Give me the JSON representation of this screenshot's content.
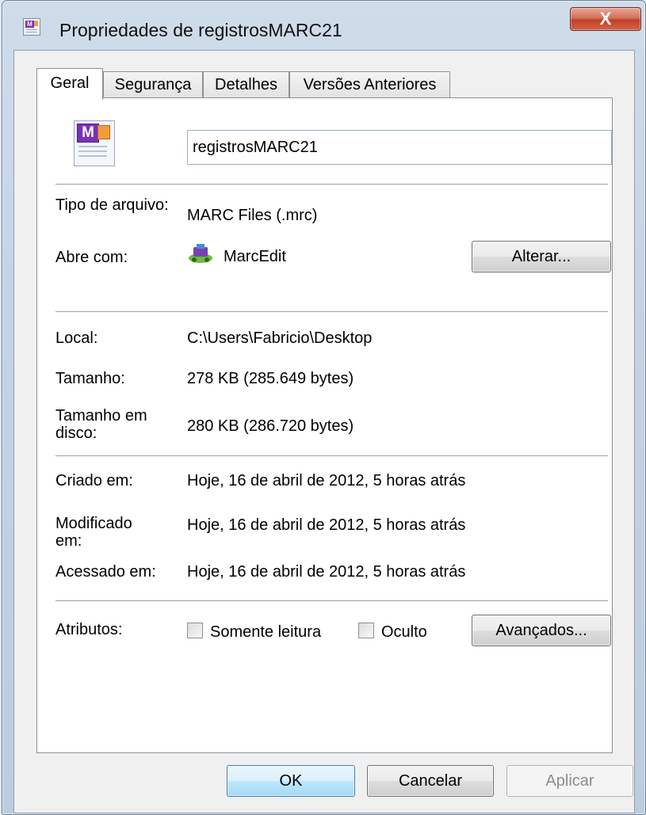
{
  "window": {
    "title": "Propriedades de registrosMARC21",
    "close_label": "X",
    "icon": "marc-file-icon"
  },
  "tabs": [
    {
      "label": "Geral",
      "active": true
    },
    {
      "label": "Segurança",
      "active": false
    },
    {
      "label": "Detalhes",
      "active": false
    },
    {
      "label": "Versões Anteriores",
      "active": false
    }
  ],
  "general": {
    "filename": "registrosMARC21",
    "file_type_label": "Tipo de arquivo:",
    "file_type_value": "MARC Files (.mrc)",
    "opens_with_label": "Abre com:",
    "opens_with_value": "MarcEdit",
    "change_button": "Alterar...",
    "location_label": "Local:",
    "location_value": "C:\\Users\\Fabricio\\Desktop",
    "size_label": "Tamanho:",
    "size_value": "278 KB (285.649 bytes)",
    "size_on_disk_label": "Tamanho em disco:",
    "size_on_disk_value": "280 KB (286.720 bytes)",
    "created_label": "Criado em:",
    "created_value": "Hoje, 16 de abril de 2012, 5 horas atrás",
    "modified_label": "Modificado em:",
    "modified_value": "Hoje, 16 de abril de 2012, 5 horas atrás",
    "accessed_label": "Acessado em:",
    "accessed_value": "Hoje, 16 de abril de 2012, 5 horas atrás",
    "attributes_label": "Atributos:",
    "readonly_label": "Somente leitura",
    "hidden_label": "Oculto",
    "advanced_button": "Avançados..."
  },
  "buttons": {
    "ok": "OK",
    "cancel": "Cancelar",
    "apply": "Aplicar"
  }
}
